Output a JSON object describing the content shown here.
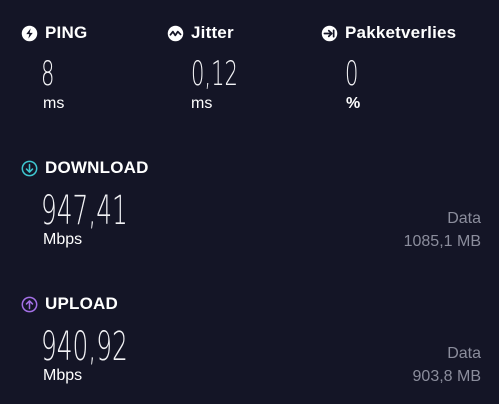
{
  "ping": {
    "label": "PING",
    "value": "8",
    "unit": "ms",
    "icon": "ping-icon"
  },
  "jitter": {
    "label": "Jitter",
    "value": "0,12",
    "unit": "ms",
    "icon": "jitter-icon"
  },
  "packet_loss": {
    "label": "Pakketverlies",
    "value": "0",
    "unit": "%",
    "icon": "packet-loss-icon"
  },
  "download": {
    "label": "DOWNLOAD",
    "value": "947,41",
    "unit": "Mbps",
    "data_label": "Data",
    "data_value": "1085,1 MB",
    "icon": "download-arrow-icon",
    "accent": "#3ec6d0"
  },
  "upload": {
    "label": "UPLOAD",
    "value": "940,92",
    "unit": "Mbps",
    "data_label": "Data",
    "data_value": "903,8 MB",
    "icon": "upload-arrow-icon",
    "accent": "#a470e6"
  },
  "colors": {
    "background": "#141526",
    "text": "#ffffff",
    "muted": "#8b8d9c"
  }
}
